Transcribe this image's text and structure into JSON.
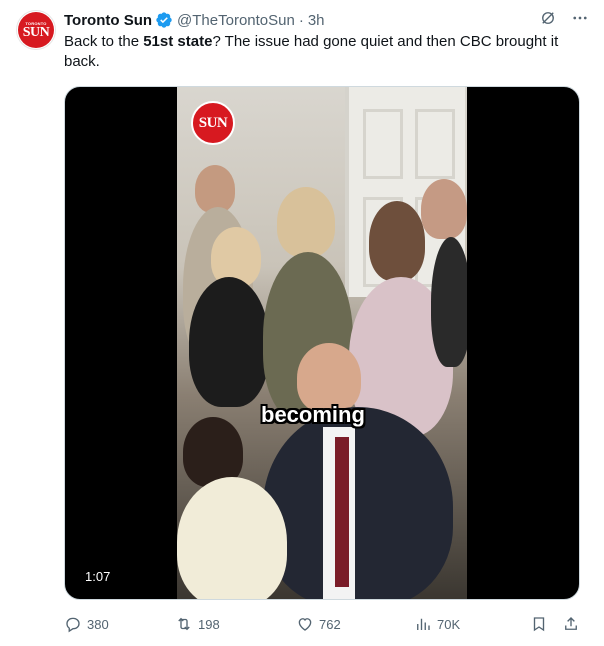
{
  "account": {
    "name": "Toronto Sun",
    "handle": "@TheTorontoSun",
    "separator": "·",
    "time": "3h",
    "avatar_small_text": "TORONTO",
    "avatar_text": "SUN"
  },
  "tweet": {
    "text_before": "Back to the ",
    "text_bold": "51st state",
    "text_after": "? The issue had gone quiet and then CBC brought it back."
  },
  "video": {
    "logo_text": "SUN",
    "caption": "becoming",
    "duration": "1:07"
  },
  "actions": {
    "replies": "380",
    "reposts": "198",
    "likes": "762",
    "views": "70K"
  },
  "colors": {
    "brand_red": "#d71920",
    "verified_blue": "#1d9bf0",
    "secondary_text": "#536471",
    "primary_text": "#0f1419"
  },
  "icons": [
    "verified-badge-icon",
    "grok-icon",
    "more-icon",
    "reply-icon",
    "retweet-icon",
    "like-icon",
    "views-icon",
    "bookmark-icon",
    "share-icon"
  ]
}
